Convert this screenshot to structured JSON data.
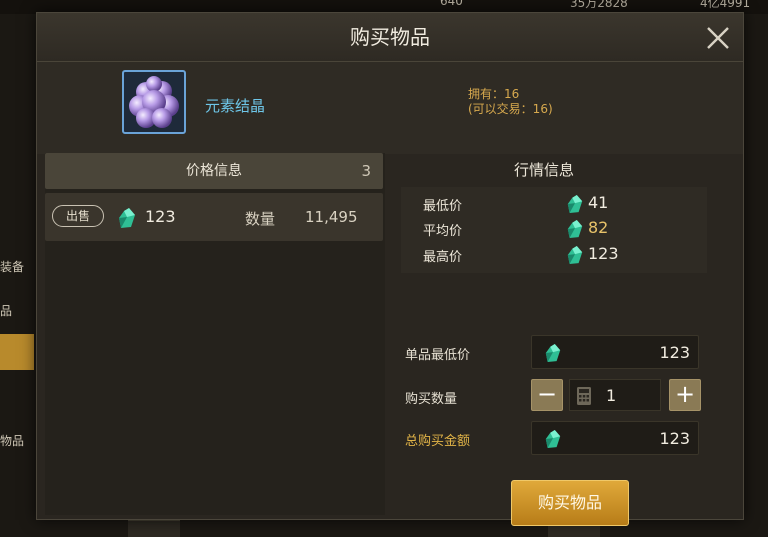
{
  "background": {
    "currencies": [
      {
        "value": "640",
        "icon": "plus-icon"
      },
      {
        "value": "35万2828",
        "icon": "plus-icon"
      },
      {
        "value": "4亿4991",
        "icon": "gold-coin-icon"
      }
    ],
    "side_menu": [
      "装备",
      "品",
      "",
      "物品"
    ]
  },
  "dialog": {
    "title": "购买物品",
    "close_icon": "close-icon"
  },
  "item": {
    "name": "元素结晶",
    "owned": "拥有：16",
    "tradable": "(可以交易：16)",
    "icon": "element-crystal-icon"
  },
  "price_info": {
    "title": "价格信息",
    "count": "3",
    "listings": [
      {
        "badge": "出售",
        "price": "123",
        "qty_label": "数量",
        "qty": "11,495"
      }
    ]
  },
  "market": {
    "title": "行情信息",
    "rows": [
      {
        "label": "最低价",
        "value": "41"
      },
      {
        "label": "平均价",
        "value": "82"
      },
      {
        "label": "最高价",
        "value": "123"
      }
    ]
  },
  "purchase": {
    "unit_price_label": "单品最低价",
    "unit_price": "123",
    "qty_label": "购买数量",
    "qty": "1",
    "minus": "−",
    "plus": "+",
    "total_label": "总购买金额",
    "total": "123",
    "buy_button": "购买物品"
  },
  "colors": {
    "gem": "#35d1a4",
    "gold_text": "#e2b447",
    "cyan_text": "#6ec6e8",
    "buy_button": "#d59a2b"
  }
}
